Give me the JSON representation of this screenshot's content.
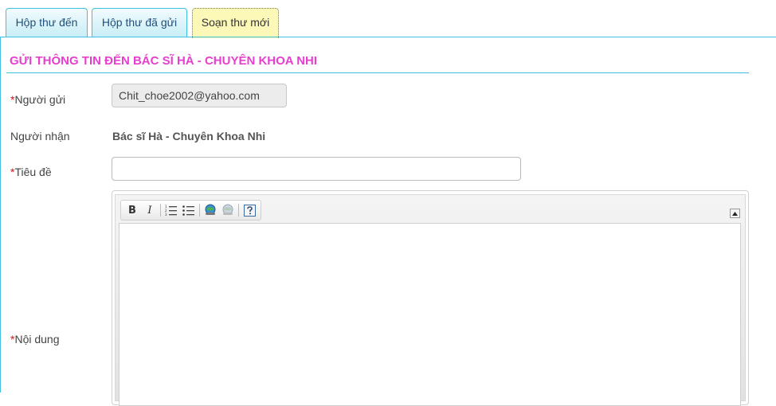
{
  "tabs": [
    {
      "label": "Hộp thư đến",
      "active": false
    },
    {
      "label": "Hộp thư đã gửi",
      "active": false
    },
    {
      "label": "Soạn thư mới",
      "active": true
    }
  ],
  "form": {
    "title": "GỬI THÔNG TIN ĐẾN BÁC SĨ HÀ - CHUYÊN KHOA NHI",
    "required_marker": "*",
    "sender_label": "Người gửi",
    "sender_value": "Chit_choe2002@yahoo.com",
    "recipient_label": "Người nhận",
    "recipient_value": "Bác sĩ Hà - Chuyên Khoa Nhi",
    "subject_label": "Tiêu đề",
    "subject_value": "",
    "content_label": "Nội dung"
  },
  "toolbar": {
    "bold": "B",
    "italic": "I",
    "icons": [
      "bold-icon",
      "italic-icon",
      "ordered-list-icon",
      "unordered-list-icon",
      "link-icon",
      "unlink-icon",
      "help-icon"
    ]
  },
  "colors": {
    "accent": "#40c0e0",
    "title": "#e83ed0",
    "required": "#dd1111",
    "active_tab": "#fbf8b8"
  }
}
